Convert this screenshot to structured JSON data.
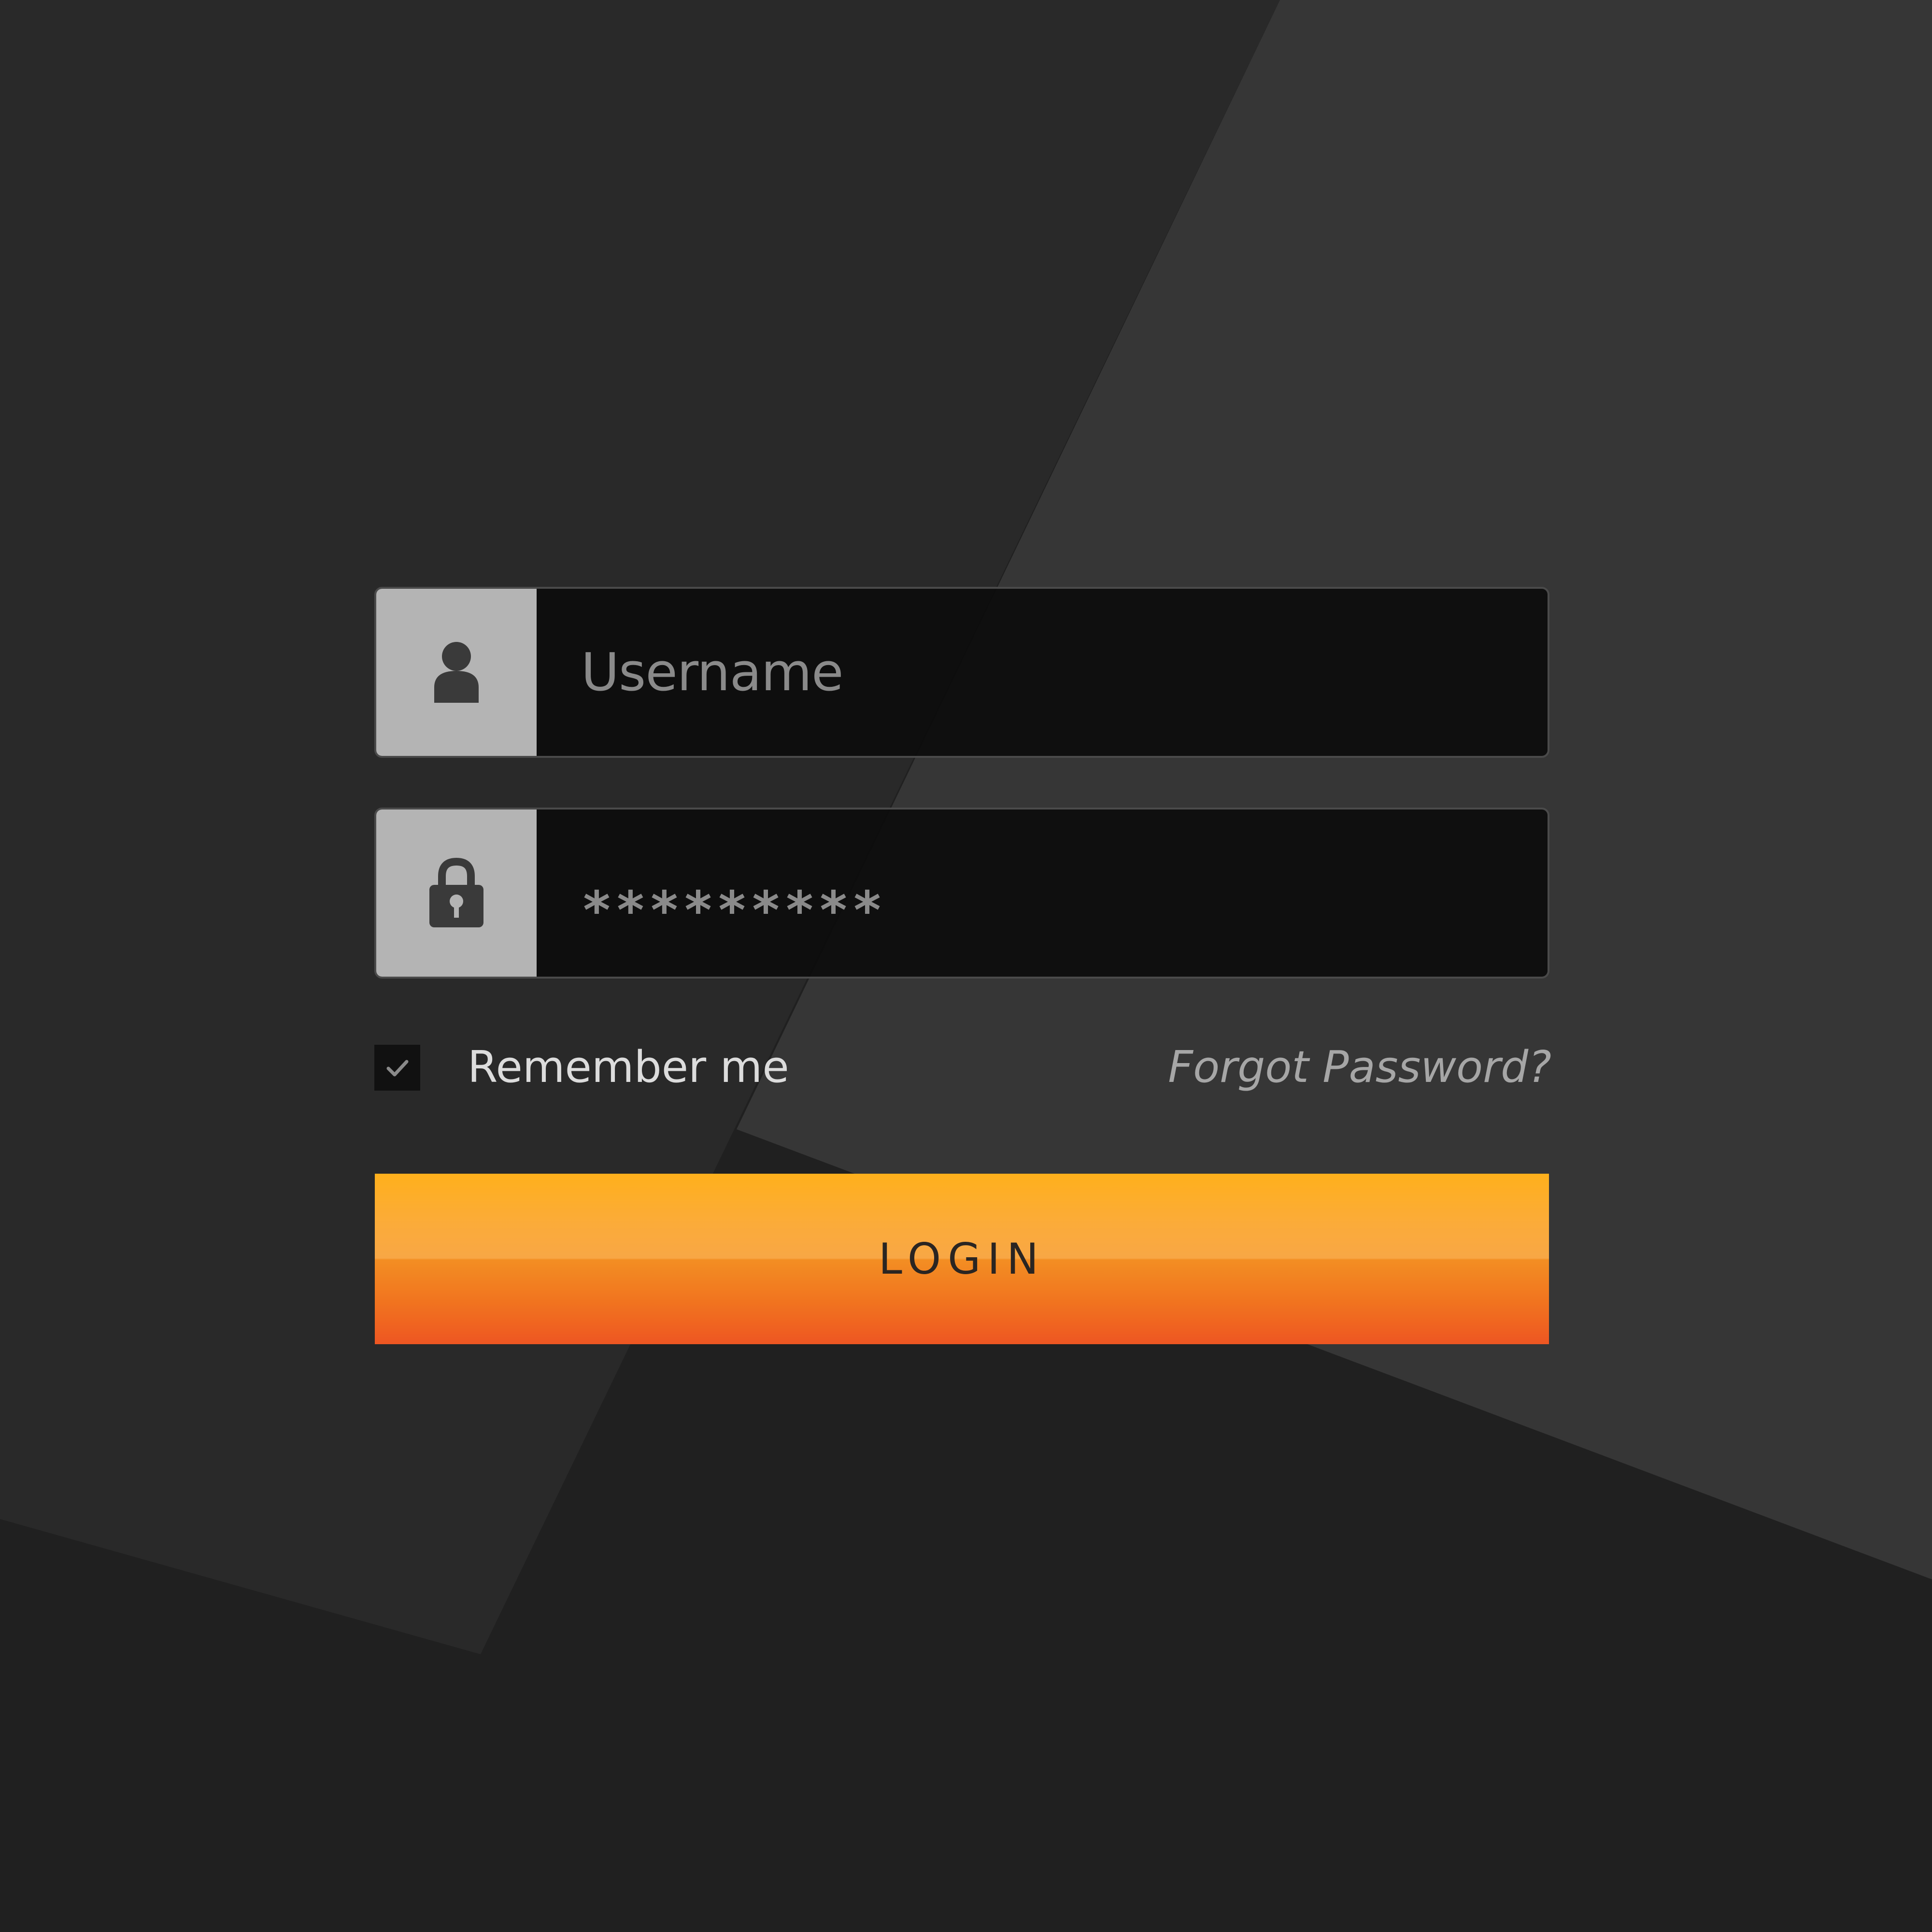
{
  "login_form": {
    "username": {
      "placeholder": "Username",
      "icon": "user-icon"
    },
    "password": {
      "masked_value": "*********",
      "icon": "lock-icon"
    },
    "remember_me": {
      "label": "Remember me",
      "checked": true,
      "icon": "checkmark-icon"
    },
    "forgot_password": {
      "label": "Forgot Password?"
    },
    "login_button": {
      "label": "LOGIN"
    }
  },
  "colors": {
    "background": "#202020",
    "field_background": "#111111",
    "icon_box": "#b4b4b4",
    "button_gradient_top": "#ffb01c",
    "button_gradient_bottom": "#ee5622"
  }
}
